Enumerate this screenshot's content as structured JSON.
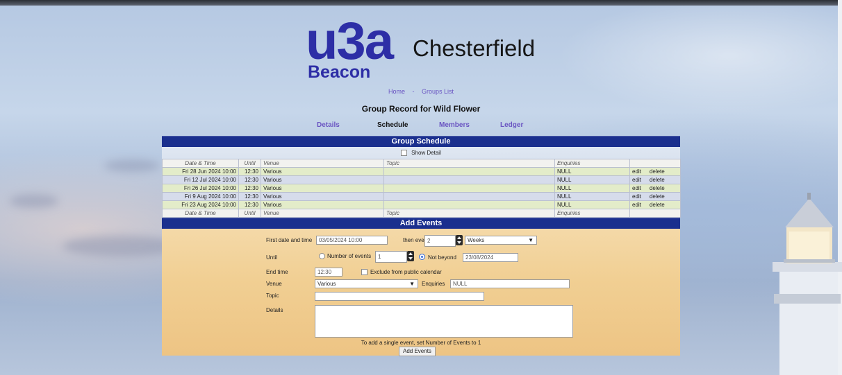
{
  "branding": {
    "logo_main": "u3a",
    "logo_sub": "Beacon",
    "place": "Chesterfield"
  },
  "nav": {
    "home": "Home",
    "separator": "-",
    "groups_list": "Groups List"
  },
  "page_title": "Group Record for Wild Flower",
  "tabs": {
    "details": "Details",
    "schedule": "Schedule",
    "members": "Members",
    "ledger": "Ledger"
  },
  "schedule": {
    "title": "Group Schedule",
    "show_detail_label": "Show Detail",
    "columns": {
      "date_time": "Date & Time",
      "until": "Until",
      "venue": "Venue",
      "topic": "Topic",
      "enquiries": "Enquiries"
    },
    "rows": [
      {
        "date_time": "Fri 28 Jun 2024 10:00",
        "until": "12:30",
        "venue": "Various",
        "topic": "",
        "enquiries": "NULL",
        "edit": "edit",
        "delete": "delete"
      },
      {
        "date_time": "Fri 12 Jul 2024 10:00",
        "until": "12:30",
        "venue": "Various",
        "topic": "",
        "enquiries": "NULL",
        "edit": "edit",
        "delete": "delete"
      },
      {
        "date_time": "Fri 26 Jul 2024 10:00",
        "until": "12:30",
        "venue": "Various",
        "topic": "",
        "enquiries": "NULL",
        "edit": "edit",
        "delete": "delete"
      },
      {
        "date_time": "Fri 9 Aug 2024 10:00",
        "until": "12:30",
        "venue": "Various",
        "topic": "",
        "enquiries": "NULL",
        "edit": "edit",
        "delete": "delete"
      },
      {
        "date_time": "Fri 23 Aug 2024 10:00",
        "until": "12:30",
        "venue": "Various",
        "topic": "",
        "enquiries": "NULL",
        "edit": "edit",
        "delete": "delete"
      }
    ]
  },
  "add_events": {
    "title": "Add Events",
    "first_date_label": "First date and time",
    "first_date_value": "03/05/2024 10:00",
    "then_every_label": "then every",
    "interval_value": "2",
    "interval_unit": "Weeks",
    "until_label": "Until",
    "number_of_events_label": "Number of events",
    "number_of_events_value": "1",
    "not_beyond_label": "Not beyond",
    "not_beyond_value": "23/08/2024",
    "end_time_label": "End time",
    "end_time_value": "12:30",
    "exclude_label": "Exclude from public calendar",
    "venue_label": "Venue",
    "venue_value": "Various",
    "enquiries_label": "Enquiries",
    "enquiries_value": "NULL",
    "topic_label": "Topic",
    "topic_value": "",
    "details_label": "Details",
    "details_value": "",
    "hint": "To add a single event, set Number of Events to 1",
    "submit_label": "Add Events"
  },
  "colors": {
    "brand": "#2d2ea6",
    "section_header": "#1a2f8e",
    "link": "#6a55c2",
    "form_bg": "#f1cf93"
  }
}
